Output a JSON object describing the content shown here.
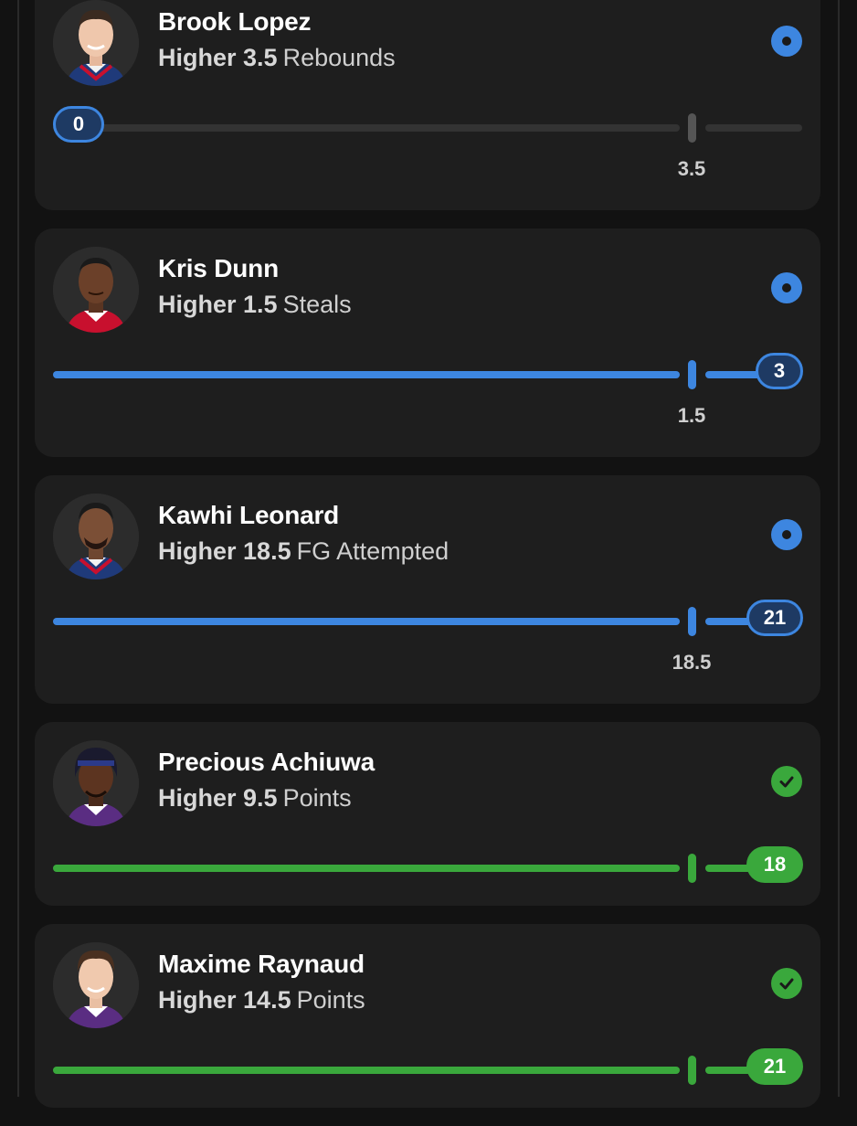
{
  "colors": {
    "pending_blue": "#3d86e0",
    "win_green": "#3aa83c",
    "card_bg": "#1e1e1e",
    "page_bg": "#121212"
  },
  "picks": [
    {
      "player": "Brook Lopez",
      "direction": "Higher",
      "line": "3.5",
      "stat": "Rebounds",
      "current": "0",
      "progress_fraction": 0,
      "status": "pending",
      "status_icon": "dot-icon"
    },
    {
      "player": "Kris Dunn",
      "direction": "Higher",
      "line": "1.5",
      "stat": "Steals",
      "current": "3",
      "progress_fraction": 1,
      "status": "pending",
      "status_icon": "dot-icon"
    },
    {
      "player": "Kawhi Leonard",
      "direction": "Higher",
      "line": "18.5",
      "stat": "FG Attempted",
      "current": "21",
      "progress_fraction": 1,
      "status": "pending",
      "status_icon": "dot-icon"
    },
    {
      "player": "Precious Achiuwa",
      "direction": "Higher",
      "line": "9.5",
      "stat": "Points",
      "current": "18",
      "progress_fraction": 1,
      "status": "won",
      "status_icon": "check-icon"
    },
    {
      "player": "Maxime Raynaud",
      "direction": "Higher",
      "line": "14.5",
      "stat": "Points",
      "current": "21",
      "progress_fraction": 1,
      "status": "won",
      "status_icon": "check-icon"
    }
  ]
}
